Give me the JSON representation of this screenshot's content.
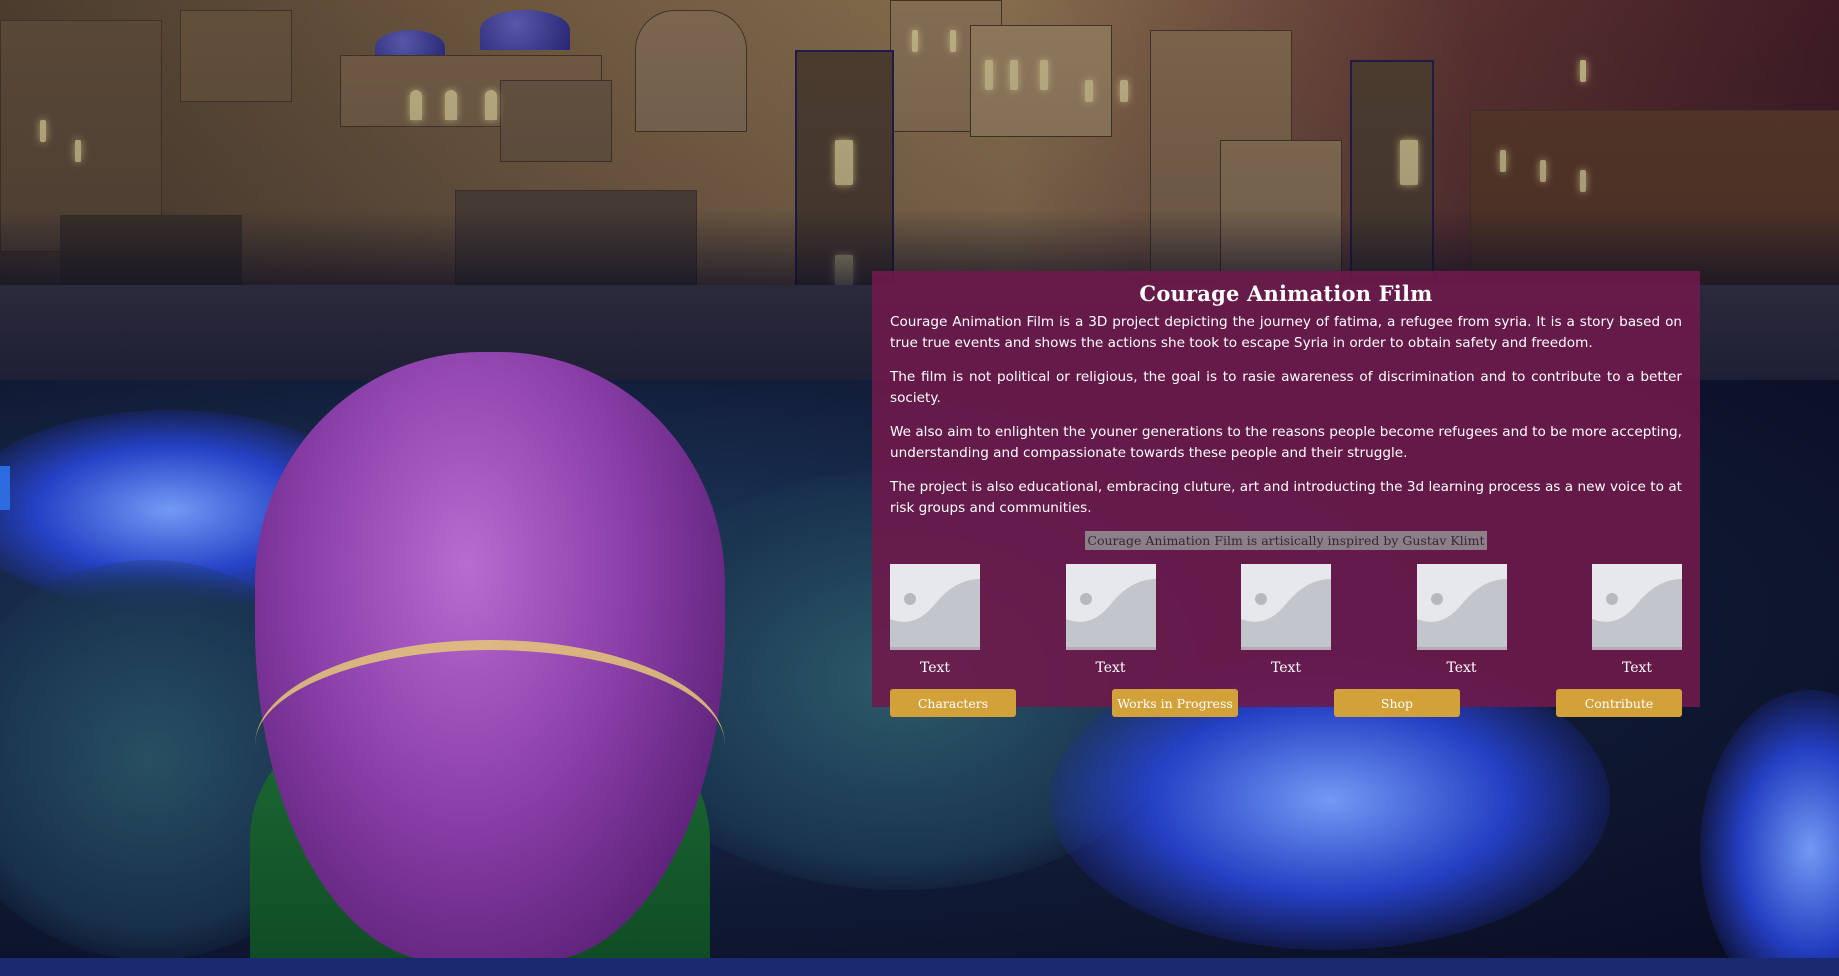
{
  "panel": {
    "title": "Courage Animation Film",
    "paragraphs": [
      "Courage Animation Film is a 3D project depicting the journey of fatima, a refugee from syria. It is a story based on true true events and shows the actions she took to escape Syria in order to obtain safety and freedom.",
      "The film is not political or religious, the goal is to rasie awareness of discrimination and to contribute to a better society.",
      "We also aim to enlighten the youner generations to the reasons people become refugees and to be more accepting, understanding and compassionate towards these people and their struggle.",
      "The project is also educational, embracing cluture, art and introducting the 3d learning process as a new voice to at risk groups and communities."
    ],
    "credit": "Courage Animation Film is artisically inspired by Gustav Klimt",
    "thumbnails": [
      {
        "label": "Text",
        "icon": "image-placeholder-icon"
      },
      {
        "label": "Text",
        "icon": "image-placeholder-icon"
      },
      {
        "label": "Text",
        "icon": "image-placeholder-icon"
      },
      {
        "label": "Text",
        "icon": "image-placeholder-icon"
      },
      {
        "label": "Text",
        "icon": "image-placeholder-icon"
      }
    ],
    "buttons": {
      "characters": "Characters",
      "works_in_progress": "Works in Progress",
      "shop": "Shop",
      "contribute": "Contribute"
    }
  },
  "colors": {
    "panel_bg": "#6e194b",
    "button_bg": "#d3a13a",
    "credit_bg": "#8d7f88",
    "text": "#ffffff"
  }
}
